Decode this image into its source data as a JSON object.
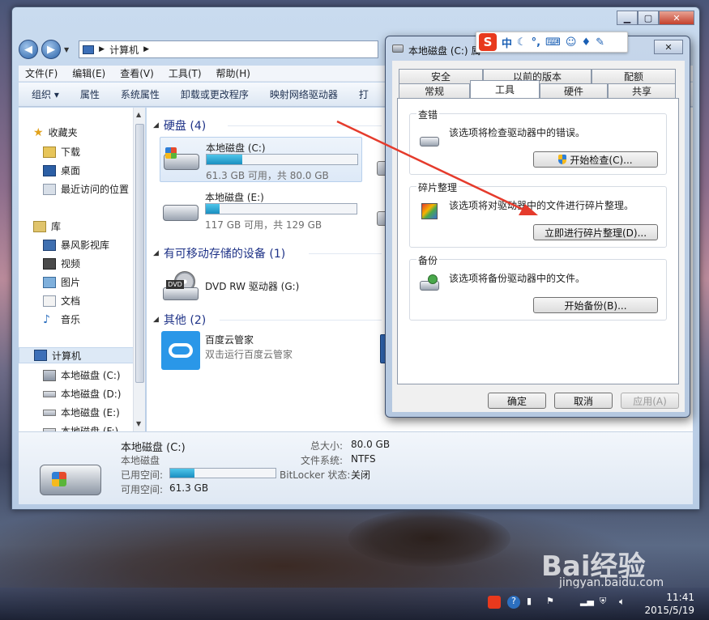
{
  "explorer": {
    "address": "计算机",
    "menu": [
      "文件(F)",
      "编辑(E)",
      "查看(V)",
      "工具(T)",
      "帮助(H)"
    ],
    "toolbar": [
      "组织 ▾",
      "属性",
      "系统属性",
      "卸载或更改程序",
      "映射网络驱动器",
      "打"
    ],
    "sidebar": {
      "favorites": "收藏夹",
      "fav_items": [
        "下载",
        "桌面",
        "最近访问的位置"
      ],
      "libraries": "库",
      "lib_items": [
        "暴风影视库",
        "视频",
        "图片",
        "文档",
        "音乐"
      ],
      "computer": "计算机",
      "drives": [
        "本地磁盘 (C:)",
        "本地磁盘 (D:)",
        "本地磁盘 (E:)",
        "本地磁盘 (F:)"
      ]
    },
    "groups": {
      "hdd": "硬盘 (4)",
      "removable": "有可移动存储的设备 (1)",
      "other": "其他 (2)"
    },
    "drives": [
      {
        "name": "本地磁盘 (C:)",
        "info": "61.3 GB 可用，共 80.0 GB",
        "used_fraction": 0.234
      },
      {
        "name": "本地磁盘 (E:)",
        "info": "117 GB 可用，共 129 GB",
        "used_fraction": 0.093
      }
    ],
    "dvd": {
      "name": "DVD RW 驱动器 (G:)",
      "label": "DVD"
    },
    "baidu": {
      "name": "百度云管家",
      "desc": "双击运行百度云管家"
    },
    "details": {
      "name": "本地磁盘 (C:)",
      "type": "本地磁盘",
      "used_label": "已用空间:",
      "used_fraction": 0.234,
      "free_label": "可用空间:",
      "free_value": "61.3 GB",
      "total_label": "总大小:",
      "total_value": "80.0 GB",
      "fs_label": "文件系统:",
      "fs_value": "NTFS",
      "bitlocker_label": "BitLocker 状态:",
      "bitlocker_value": "关闭"
    }
  },
  "dialog": {
    "title": "本地磁盘 (C:) 属",
    "tabs_row1": [
      "安全",
      "以前的版本",
      "配额"
    ],
    "tabs_row2": [
      "常规",
      "工具",
      "硬件",
      "共享"
    ],
    "active_tab": "工具",
    "groups": [
      {
        "title": "查错",
        "text": "该选项将检查驱动器中的错误。",
        "button": "开始检查(C)..."
      },
      {
        "title": "碎片整理",
        "text": "该选项将对驱动器中的文件进行碎片整理。",
        "button": "立即进行碎片整理(D)..."
      },
      {
        "title": "备份",
        "text": "该选项将备份驱动器中的文件。",
        "button": "开始备份(B)..."
      }
    ],
    "ok": "确定",
    "cancel": "取消",
    "apply": "应用(A)"
  },
  "ime": {
    "logo": "S",
    "mode": "中"
  },
  "taskbar": {
    "time": "11:41",
    "date": "2015/5/19"
  },
  "watermark": {
    "logo": "Bai经验",
    "site": "jingyan.baidu.com"
  },
  "colors": {
    "accent": "#1a8fc0",
    "arrow": "#e53b2c"
  }
}
